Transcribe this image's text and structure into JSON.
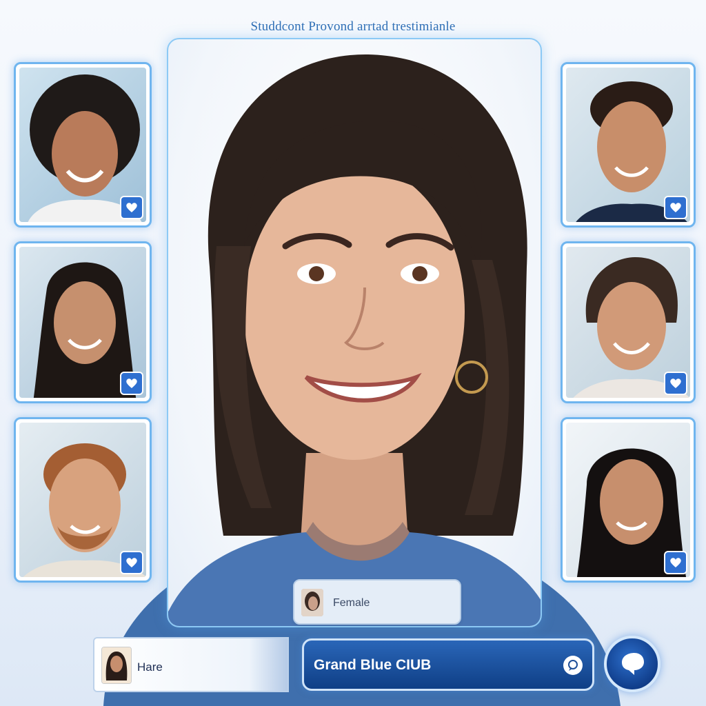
{
  "header": {
    "title": "Studdcont Provond arrtad trestimianle"
  },
  "profile": {
    "gender_label": "Female"
  },
  "user_bar": {
    "name": "Hare"
  },
  "club_button": {
    "label": "Grand Blue CIUB"
  },
  "thumbnails": [
    {
      "icon": "heart-icon"
    },
    {
      "icon": "heart-icon"
    },
    {
      "icon": "heart-icon"
    },
    {
      "icon": "heart-icon"
    },
    {
      "icon": "heart-icon"
    },
    {
      "icon": "heart-icon"
    }
  ],
  "colors": {
    "accent": "#2e6fd0",
    "frame_glow": "#6fb5ef",
    "button_dark": "#0f3f86"
  }
}
